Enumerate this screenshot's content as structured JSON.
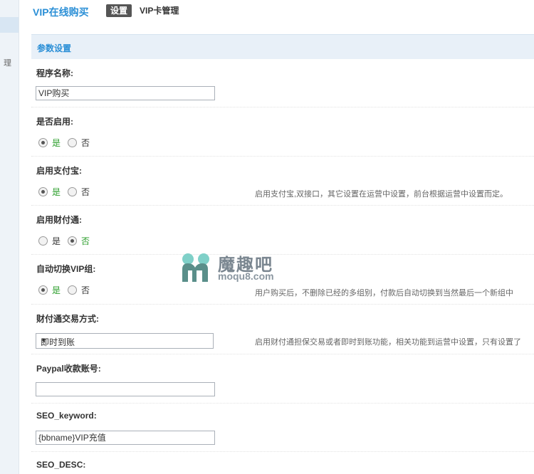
{
  "header": {
    "app_title": "VIP在线购买",
    "tabs": [
      {
        "label": "设置",
        "active": true
      },
      {
        "label": "VIP卡管理",
        "active": false
      }
    ]
  },
  "leftnav": {
    "glyph": "理"
  },
  "section": {
    "title": "参数设置"
  },
  "fields": {
    "program_name": {
      "label": "程序名称:",
      "value": "VIP购买"
    },
    "enabled": {
      "label": "是否启用:",
      "options": [
        "是",
        "否"
      ],
      "selected": "是"
    },
    "alipay": {
      "label": "启用支付宝:",
      "options": [
        "是",
        "否"
      ],
      "selected": "是",
      "tip": "启用支付宝,双接口，其它设置在运营中设置，前台根据运营中设置而定。"
    },
    "tenpay": {
      "label": "启用财付通:",
      "options": [
        "是",
        "否"
      ],
      "selected": "否"
    },
    "auto_switch": {
      "label": "自动切换VIP组:",
      "options": [
        "是",
        "否"
      ],
      "selected": "是",
      "tip": "用户购买后，不删除已经的多组别，付款后自动切换到当然最后一个新组中"
    },
    "tenpay_mode": {
      "label": "财付通交易方式:",
      "value": "即时到账",
      "tip": "启用财付通担保交易或者即时到账功能，相关功能到运营中设置，只有设置了"
    },
    "paypal": {
      "label": "Paypal收款账号:",
      "value": ""
    },
    "seo_keyword": {
      "label": "SEO_keyword:",
      "value": "{bbname}VIP充值"
    },
    "seo_desc": {
      "label": "SEO_DESC:"
    }
  },
  "watermark": {
    "brand": "魔趣吧",
    "url": "moqu8.com"
  },
  "colors": {
    "accent": "#2b8fd6",
    "selected_option": "#2a9d2a",
    "section_bg": "#e8f0f8"
  }
}
